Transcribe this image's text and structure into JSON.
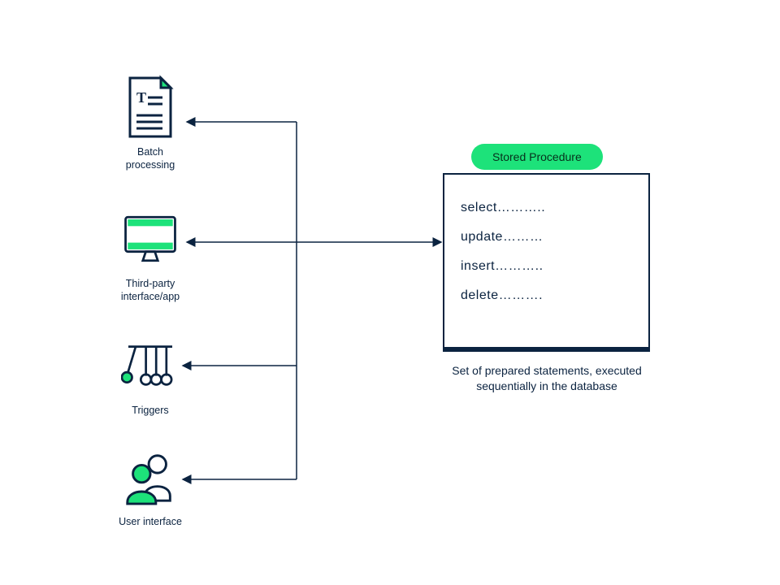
{
  "colors": {
    "ink": "#0b2340",
    "accent": "#1de27a"
  },
  "nodes": {
    "batch": {
      "label": "Batch\nprocessing",
      "icon": "document-text-icon"
    },
    "thirdparty": {
      "label": "Third-party\ninterface/app",
      "icon": "monitor-icon"
    },
    "triggers": {
      "label": "Triggers",
      "icon": "pendulum-icon"
    },
    "user": {
      "label": "User interface",
      "icon": "users-icon"
    }
  },
  "stored_procedure": {
    "pill_label": "Stored Procedure",
    "statements": [
      "select………..",
      "update………",
      "insert………..",
      "delete………."
    ],
    "caption": "Set of prepared statements, executed sequentially in the database"
  }
}
